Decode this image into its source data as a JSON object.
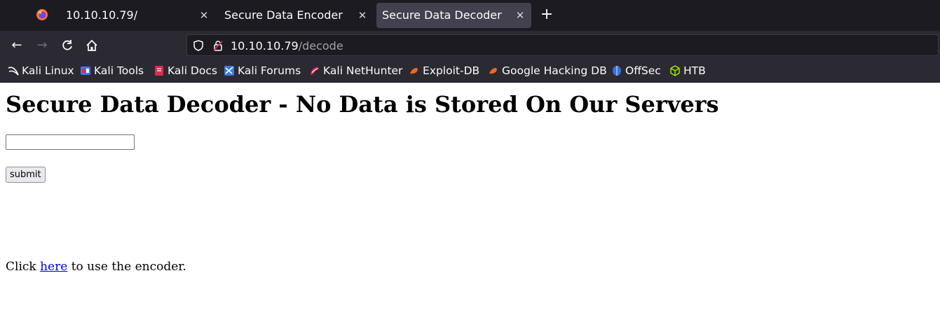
{
  "browser": {
    "tabs": [
      {
        "title": "10.10.10.79/",
        "active": false
      },
      {
        "title": "Secure Data Encoder",
        "active": false
      },
      {
        "title": "Secure Data Decoder",
        "active": true
      }
    ],
    "new_tab_icon": "plus-icon",
    "url": {
      "host": "10.10.10.79",
      "path": "/decode"
    },
    "bookmarks": [
      {
        "label": "Kali Linux",
        "icon": "kali-dragon-icon"
      },
      {
        "label": "Kali Tools",
        "icon": "kali-tools-icon"
      },
      {
        "label": "Kali Docs",
        "icon": "kali-docs-icon"
      },
      {
        "label": "Kali Forums",
        "icon": "kali-forums-icon"
      },
      {
        "label": "Kali NetHunter",
        "icon": "kali-nethunter-icon"
      },
      {
        "label": "Exploit-DB",
        "icon": "exploit-db-icon"
      },
      {
        "label": "Google Hacking DB",
        "icon": "ghdb-icon"
      },
      {
        "label": "OffSec",
        "icon": "offsec-icon"
      },
      {
        "label": "HTB",
        "icon": "htb-cube-icon"
      }
    ]
  },
  "page": {
    "title": "Secure Data Decoder - No Data is Stored On Our Servers",
    "input_value": "",
    "submit_label": "submit",
    "footer": {
      "before": "Click ",
      "link": "here",
      "after": " to use the encoder."
    }
  },
  "colors": {
    "tab_bar": "#1c1b22",
    "toolbar": "#2b2a33",
    "active_tab": "#42414d",
    "link": "#0000ee"
  }
}
